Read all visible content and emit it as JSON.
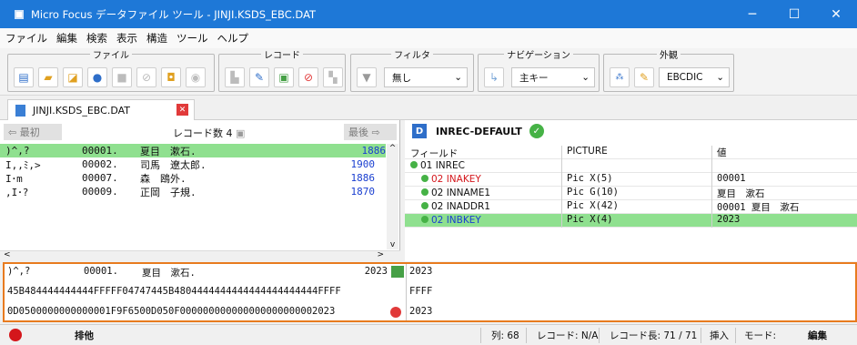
{
  "window": {
    "title": "Micro Focus データファイル ツール - JINJI.KSDS_EBC.DAT"
  },
  "menu": [
    "ファイル",
    "編集",
    "検索",
    "表示",
    "構造",
    "ツール",
    "ヘルプ"
  ],
  "toolbar": {
    "file_label": "ファイル",
    "record_label": "レコード",
    "filter_label": "フィルタ",
    "filter_value": "無し",
    "nav_label": "ナビゲーション",
    "nav_value": "主キー",
    "view_label": "外観",
    "view_value": "EBCDIC"
  },
  "tab": {
    "label": "JINJI.KSDS_EBC.DAT"
  },
  "navigation": {
    "first": "最初",
    "record_count": "レコード数 4",
    "last": "最後"
  },
  "records": [
    {
      "raw": ")^,?",
      "key": "00001.",
      "name": "夏目　漱石.",
      "year": "1886",
      "selected": true
    },
    {
      "raw": "I,,ﾐ,>",
      "key": "00002.",
      "name": "司馬　遼太郎.",
      "year": "1900",
      "selected": false
    },
    {
      "raw": "I･m",
      "key": "00007.",
      "name": "森　鴎外.",
      "year": "1886",
      "selected": false
    },
    {
      "raw": ",I･?",
      "key": "00009.",
      "name": "正岡　子規.",
      "year": "1870",
      "selected": false
    }
  ],
  "layout_panel": {
    "name": "INREC-DEFAULT",
    "headers": {
      "field": "フィールド",
      "picture": "PICTURE",
      "value": "値"
    },
    "fields": [
      {
        "name": "01 INREC",
        "picture": "",
        "value": "",
        "key": false,
        "selected": false,
        "level": 0
      },
      {
        "name": "02 INAKEY",
        "picture": "Pic X(5)",
        "value": "00001",
        "key": true,
        "selected": false,
        "level": 1
      },
      {
        "name": "02 INNAME1",
        "picture": "Pic G(10)",
        "value": "夏目　漱石",
        "key": false,
        "selected": false,
        "level": 1
      },
      {
        "name": "02 INADDR1",
        "picture": "Pic X(42)",
        "value": "00001 夏目　漱石",
        "key": false,
        "selected": false,
        "level": 1
      },
      {
        "name": "02 INBKEY",
        "picture": "Pic X(4)",
        "value": "2023",
        "key": false,
        "selected": true,
        "level": 1
      }
    ]
  },
  "hex_view": {
    "left_line1_raw": ")^,?",
    "left_line1_key": "00001.",
    "left_line1_name": "夏目　漱石.",
    "left_line1_year": "2023",
    "left_line2": "45B484444444444FFFFF04747445B4804444444444444444444444FFFF",
    "left_line3": "0D0500000000000001F9F6500D050F000000000000000000000002023",
    "right_line1": "2023",
    "right_line2": "FFFF",
    "right_line3": "2023"
  },
  "status": {
    "lock": "排他",
    "column": "列: 68",
    "record": "レコード: N/A",
    "record_length": "レコード長: 71 / 71",
    "insert": "挿入",
    "mode_label": "モード:",
    "mode_value": "編集"
  },
  "colors": {
    "titlebar": "#1e78d7",
    "selected_row": "#8fe08f",
    "accent_orange": "#e87b1f",
    "key_red": "#d4161b"
  }
}
